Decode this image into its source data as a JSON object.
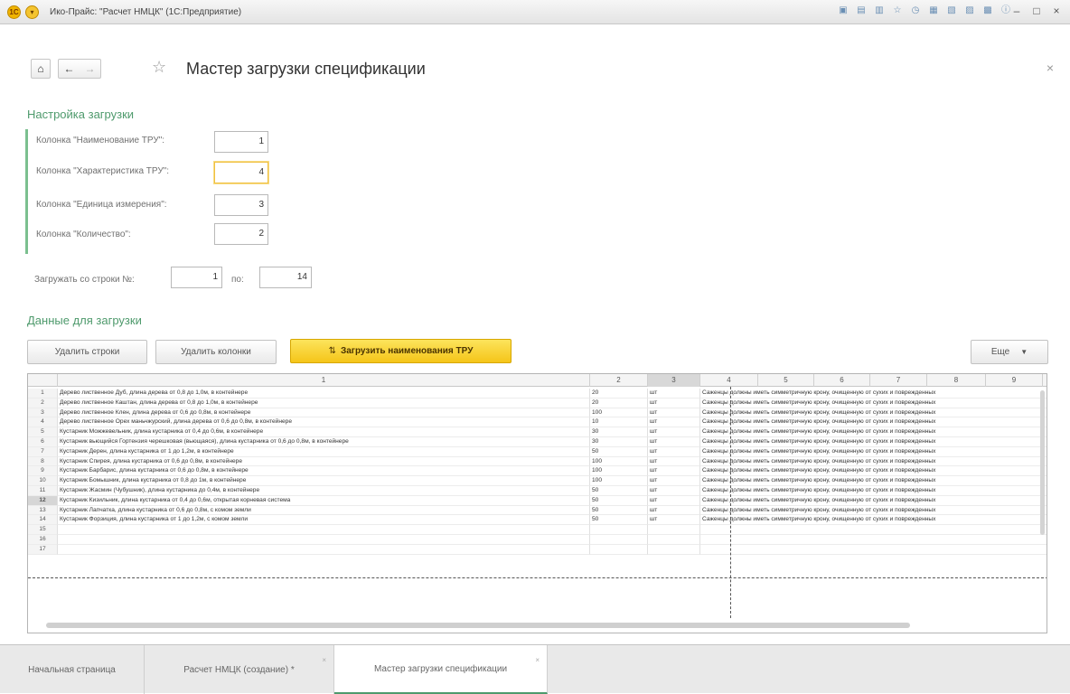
{
  "window": {
    "title": "Ико-Прайс: \"Расчет НМЦК\" (1С:Предприятие)",
    "logo": "1С"
  },
  "header": {
    "title": "Мастер загрузки спецификации",
    "close": "×"
  },
  "settings": {
    "section_title": "Настройка загрузки",
    "fields": [
      {
        "label": "Колонка \"Наименование ТРУ\":",
        "value": "1"
      },
      {
        "label": "Колонка \"Характеристика ТРУ\":",
        "value": "4"
      },
      {
        "label": "Колонка \"Единица измерения\":",
        "value": "3"
      },
      {
        "label": "Колонка \"Количество\":",
        "value": "2"
      }
    ],
    "rows_from_label": "Загружать со строки №:",
    "rows_from_value": "1",
    "rows_to_label": "по:",
    "rows_to_value": "14"
  },
  "data_section": {
    "title": "Данные для загрузки",
    "delete_rows_label": "Удалить строки",
    "delete_columns_label": "Удалить колонки",
    "load_names_label": "Загрузить наименования ТРУ",
    "more_label": "Еще"
  },
  "grid": {
    "column_headers": [
      "1",
      "2",
      "3",
      "4",
      "5",
      "6",
      "7",
      "8",
      "9",
      ""
    ],
    "characteristic": "Саженцы должны иметь симметричную крону, очищенную от сухих и поврежденных",
    "rows": [
      {
        "n": "1",
        "name": "Дерево лиственное Дуб, длина дерева от 0,8 до 1,0м, в контейнере",
        "qty": "20",
        "unit": "шт"
      },
      {
        "n": "2",
        "name": "Дерево лиственное Каштан, длина дерева от 0,8 до 1,0м, в контейнере",
        "qty": "20",
        "unit": "шт"
      },
      {
        "n": "3",
        "name": "Дерево лиственное Клен, длина дерева от 0,6 до 0,8м, в контейнере",
        "qty": "100",
        "unit": "шт"
      },
      {
        "n": "4",
        "name": "Дерево лиственное Орех маньчжурский, длина дерева от 0,6 до 0,8м, в контейнере",
        "qty": "10",
        "unit": "шт"
      },
      {
        "n": "5",
        "name": "Кустарник Можжевельник, длина кустарника от 0,4 до 0,6м, в контейнере",
        "qty": "30",
        "unit": "шт"
      },
      {
        "n": "6",
        "name": "Кустарник вьющийся Гортензия черешковая (вьющаяся), длина кустарника от 0,6 до 0,8м, в контейнере",
        "qty": "30",
        "unit": "шт"
      },
      {
        "n": "7",
        "name": "Кустарник Дерен, длина кустарника от 1 до 1,2м, в контейнере",
        "qty": "50",
        "unit": "шт"
      },
      {
        "n": "8",
        "name": "Кустарник Спирея, длина кустарника от 0,6 до 0,8м, в контейнере",
        "qty": "100",
        "unit": "шт"
      },
      {
        "n": "9",
        "name": "Кустарник Барбарис, длина кустарника от 0,6 до 0,8м, в контейнере",
        "qty": "100",
        "unit": "шт"
      },
      {
        "n": "10",
        "name": "Кустарник Бомышник, длина кустарника от 0,8 до 1м, в контейнере",
        "qty": "100",
        "unit": "шт"
      },
      {
        "n": "11",
        "name": "Кустарник Жасмин (Чубушник), длина кустарника до 0,4м, в контейнере",
        "qty": "50",
        "unit": "шт"
      },
      {
        "n": "12",
        "name": "Кустарник Кизильник, длина кустарника от 0,4 до 0,6м, открытая корневая система",
        "qty": "50",
        "unit": "шт"
      },
      {
        "n": "13",
        "name": "Кустарник Лапчатка, длина кустарника от 0,6 до 0,8м, с комом земли",
        "qty": "50",
        "unit": "шт"
      },
      {
        "n": "14",
        "name": "Кустарник Форзиция, длина кустарника от 1 до 1,2м, с комом земли",
        "qty": "50",
        "unit": "шт"
      },
      {
        "n": "15",
        "name": "",
        "qty": "",
        "unit": ""
      },
      {
        "n": "16",
        "name": "",
        "qty": "",
        "unit": ""
      },
      {
        "n": "17",
        "name": "",
        "qty": "",
        "unit": ""
      }
    ]
  },
  "tabs": [
    {
      "label": "Начальная страница",
      "closable": false
    },
    {
      "label": "Расчет НМЦК (создание) *",
      "closable": true
    },
    {
      "label": "Мастер загрузки спецификации",
      "closable": true
    }
  ],
  "colors": {
    "accent_green": "#4e9a6c",
    "primary_yellow": "#f5c519"
  }
}
